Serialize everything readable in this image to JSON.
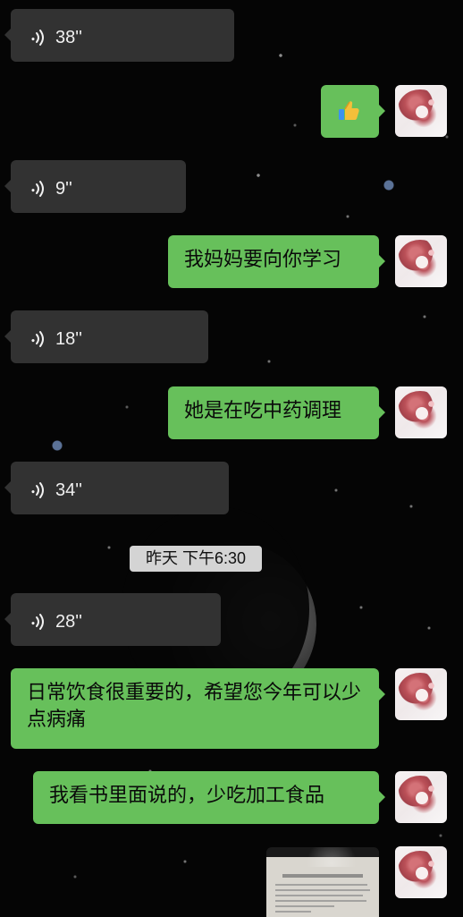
{
  "chat": {
    "messages": [
      {
        "type": "voice",
        "duration": "38''"
      },
      {
        "type": "emoji",
        "emoji": "thumbs-up"
      },
      {
        "type": "voice",
        "duration": "9''"
      },
      {
        "type": "text",
        "text": "我妈妈要向你学习"
      },
      {
        "type": "voice",
        "duration": "18''"
      },
      {
        "type": "text",
        "text": "她是在吃中药调理"
      },
      {
        "type": "voice",
        "duration": "34''"
      },
      {
        "type": "timestamp",
        "text": "昨天 下午6:30"
      },
      {
        "type": "voice",
        "duration": "28''"
      },
      {
        "type": "text",
        "text": "日常饮食很重要的，希望您今年可以少点病痛"
      },
      {
        "type": "text",
        "text": "我看书里面说的，少吃加工食品"
      },
      {
        "type": "image",
        "label": "document-photo"
      }
    ]
  },
  "colors": {
    "incoming_bubble": "#323232",
    "outgoing_bubble": "#67c05b",
    "timestamp_bg": "#e6e6e6"
  }
}
